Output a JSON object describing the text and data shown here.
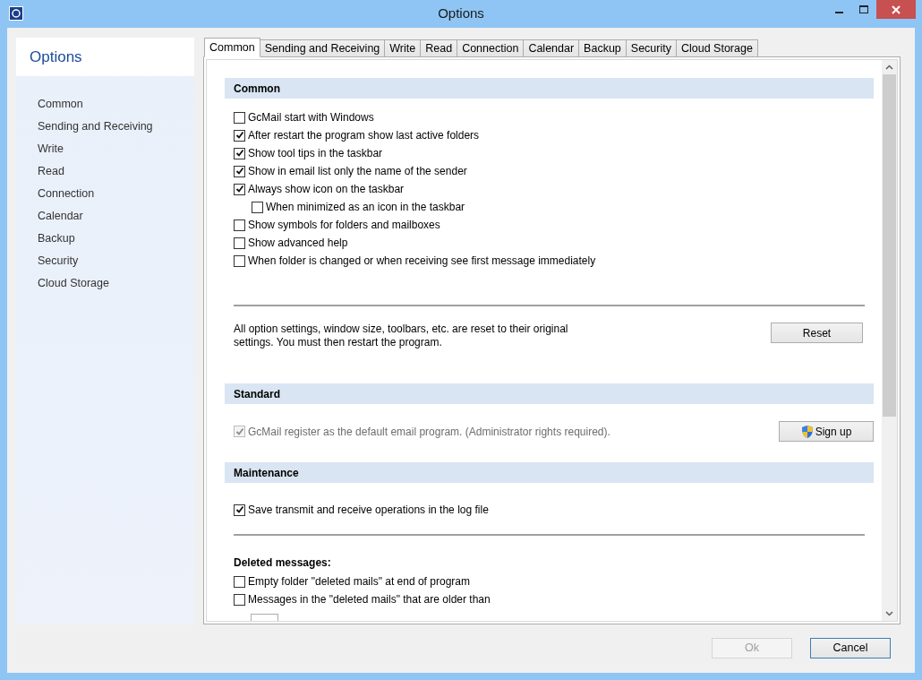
{
  "window": {
    "title": "Options"
  },
  "sidebar": {
    "title": "Options",
    "items": [
      {
        "label": "Common",
        "selected": false
      },
      {
        "label": "Sending and Receiving",
        "selected": false
      },
      {
        "label": "Write",
        "selected": false
      },
      {
        "label": "Read",
        "selected": false
      },
      {
        "label": "Connection",
        "selected": false
      },
      {
        "label": "Calendar",
        "selected": false
      },
      {
        "label": "Backup",
        "selected": false
      },
      {
        "label": "Security",
        "selected": false
      },
      {
        "label": "Cloud Storage",
        "selected": false
      }
    ]
  },
  "tabs": [
    {
      "label": "Common",
      "selected": true
    },
    {
      "label": "Sending and Receiving",
      "selected": false
    },
    {
      "label": "Write",
      "selected": false
    },
    {
      "label": "Read",
      "selected": false
    },
    {
      "label": "Connection",
      "selected": false
    },
    {
      "label": "Calendar",
      "selected": false
    },
    {
      "label": "Backup",
      "selected": false
    },
    {
      "label": "Security",
      "selected": false
    },
    {
      "label": "Cloud Storage",
      "selected": false
    }
  ],
  "blocks": [
    {
      "kind": "header",
      "title": "Common"
    },
    {
      "kind": "checkboxes",
      "items": [
        {
          "label": "GcMail start with Windows",
          "checked": false,
          "disabled": false
        },
        {
          "label": "After restart the program show last active folders",
          "checked": true,
          "disabled": false
        },
        {
          "label": "Show tool tips in the taskbar",
          "checked": true,
          "disabled": false
        },
        {
          "label": "Show in email list only the name of the sender",
          "checked": true,
          "disabled": false
        },
        {
          "label": "Always show icon on the taskbar",
          "checked": true,
          "disabled": false,
          "children": [
            {
              "label": "When minimized as an icon in the taskbar",
              "checked": false,
              "disabled": false
            }
          ]
        },
        {
          "label": "Show symbols for folders and mailboxes",
          "checked": false,
          "disabled": false
        },
        {
          "label": "Show advanced help",
          "checked": false,
          "disabled": false
        },
        {
          "label": "When folder is changed or when receiving see first message immediately",
          "checked": false,
          "disabled": false
        }
      ]
    },
    {
      "kind": "rule"
    },
    {
      "kind": "note",
      "text": "All option settings, window size, toolbars, etc. are reset to their original settings. You must then restart the program.",
      "button": "Reset"
    },
    {
      "kind": "header",
      "title": "Standard"
    },
    {
      "kind": "checkbox_button",
      "item": {
        "label": "GcMail register as the default email program. (Administrator rights required).",
        "checked": true,
        "disabled": true
      },
      "button": "Sign up"
    },
    {
      "kind": "header",
      "title": "Maintenance"
    },
    {
      "kind": "checkboxes",
      "items": [
        {
          "label": "Save transmit and receive operations in the log file",
          "checked": true,
          "disabled": false
        }
      ]
    },
    {
      "kind": "rule"
    },
    {
      "kind": "subheading",
      "title": "Deleted messages:"
    },
    {
      "kind": "checkboxes",
      "items": [
        {
          "label": "Empty folder \"deleted mails\" at end of program",
          "checked": false,
          "disabled": false
        },
        {
          "label": "Messages in the \"deleted mails\" that are older than",
          "checked": false,
          "disabled": false
        }
      ]
    },
    {
      "kind": "field"
    }
  ],
  "buttons": [
    {
      "label": "Ok",
      "disabled": true
    },
    {
      "label": "Cancel",
      "disabled": false
    }
  ]
}
